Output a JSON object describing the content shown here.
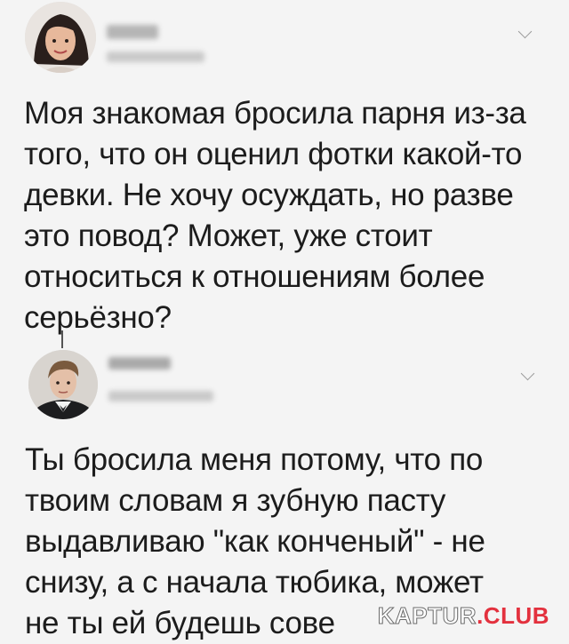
{
  "posts": [
    {
      "avatar": "woman-avatar",
      "text": "Моя знакомая бросила парня из-за\nтого, что он оценил фотки какой-то\nдевки. Не хочу осуждать, но разве\nэто повод? Может, уже стоит\nотноситься к отношениям более\nсерьёзно?"
    },
    {
      "avatar": "man-avatar",
      "text": "Ты бросила меня потому, что по\nтвоим словам я зубную пасту\nвыдавливаю \"как конченый\" - не\nснизу, а с начала тюбика, может\nне ты ей будешь сове"
    }
  ],
  "watermark": {
    "part1": "KAPTUR",
    "part2": ".CLUB"
  },
  "colors": {
    "background": "#f4f4f4",
    "text": "#1c1c1c",
    "watermark_red": "#e3313e"
  }
}
